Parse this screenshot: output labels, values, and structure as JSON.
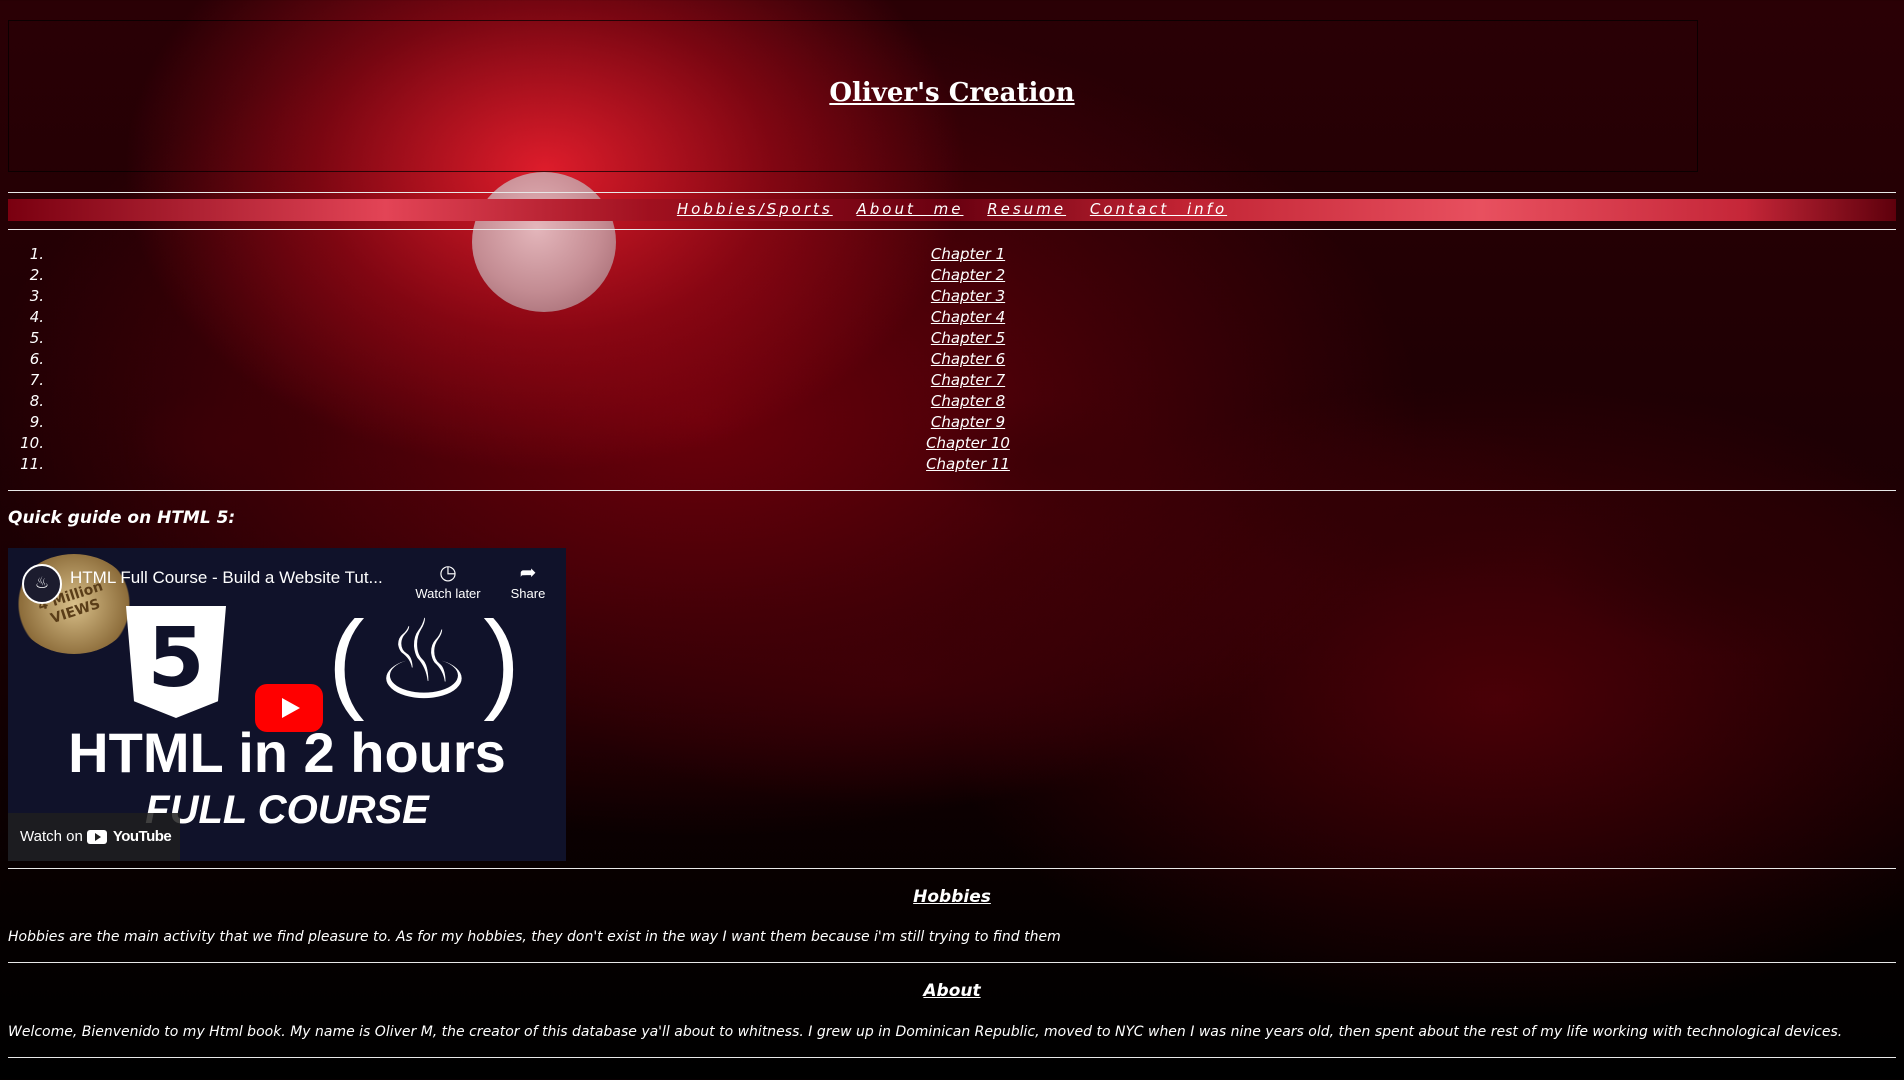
{
  "header": {
    "title": "Oliver's Creation"
  },
  "nav": {
    "items": [
      {
        "label": "Hobbies/Sports"
      },
      {
        "label": "About me"
      },
      {
        "label": "Resume"
      },
      {
        "label": "Contact info"
      }
    ]
  },
  "chapters": [
    {
      "num": "1.",
      "label": "Chapter 1"
    },
    {
      "num": "2.",
      "label": "Chapter 2"
    },
    {
      "num": "3.",
      "label": "Chapter 3"
    },
    {
      "num": "4.",
      "label": "Chapter 4"
    },
    {
      "num": "5.",
      "label": "Chapter 5"
    },
    {
      "num": "6.",
      "label": "Chapter 6"
    },
    {
      "num": "7.",
      "label": "Chapter 7"
    },
    {
      "num": "8.",
      "label": "Chapter 8"
    },
    {
      "num": "9.",
      "label": "Chapter 9"
    },
    {
      "num": "10.",
      "label": "Chapter 10"
    },
    {
      "num": "11.",
      "label": "Chapter 11"
    }
  ],
  "guide": {
    "label": "Quick guide on HTML 5:"
  },
  "video": {
    "title": "HTML Full Course - Build a Website Tut...",
    "badge": "4 Million VIEWS",
    "badge_top": "HTML",
    "watch_later": "Watch later",
    "share": "Share",
    "html5_digit": "5",
    "headline": "HTML in 2 hours",
    "subheadline": "FULL COURSE",
    "watch_on": "Watch on",
    "youtube": "YouTube"
  },
  "hobbies": {
    "heading": "Hobbies",
    "text": "Hobbies are the main activity that we find pleasure to. As for my hobbies, they don't exist in the way I want them because i'm still trying to find them"
  },
  "about": {
    "heading": "About",
    "text": "Welcome, Bienvenido to my Html book. My name is Oliver M, the creator of this database ya'll about to whitness. I grew up in Dominican Republic, moved to NYC when I was nine years old, then spent about the rest of my life working with technological devices."
  },
  "colors": {
    "background_red": "#b0101f",
    "nav_bar_red": "#e34456",
    "text": "#ffffff",
    "youtube_red": "#ff0000"
  }
}
